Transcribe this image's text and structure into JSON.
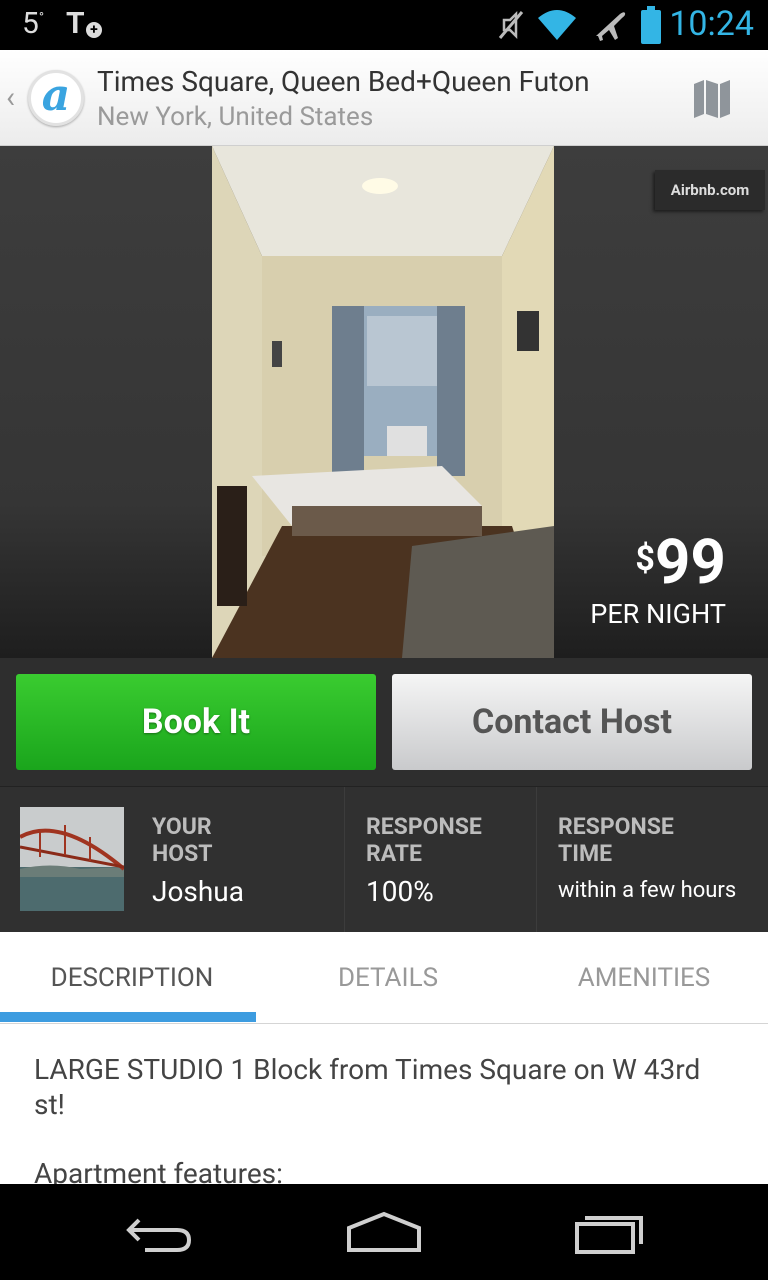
{
  "status_bar": {
    "temperature": "5",
    "temp_unit": "°",
    "t_letter": "T",
    "t_plus": "+",
    "time": "10:24",
    "icons": [
      "mute-icon",
      "wifi-icon",
      "airplane-icon",
      "battery-icon"
    ]
  },
  "header": {
    "logo_letter": "a",
    "title": "Times Square, Queen Bed+Queen Futon",
    "subtitle": "New York, United States",
    "map_icon": "map-icon"
  },
  "listing": {
    "watermark": "Airbnb.com",
    "currency": "$",
    "price": "99",
    "price_unit": "PER NIGHT"
  },
  "actions": {
    "book_label": "Book It",
    "contact_label": "Contact Host"
  },
  "host": {
    "your_host_label": [
      "YOUR",
      "HOST"
    ],
    "name": "Joshua",
    "response_rate_label": [
      "RESPONSE",
      "RATE"
    ],
    "response_rate": "100%",
    "response_time_label": [
      "RESPONSE",
      "TIME"
    ],
    "response_time": "within a few hours"
  },
  "tabs": [
    {
      "label": "DESCRIPTION",
      "active": true
    },
    {
      "label": "DETAILS",
      "active": false
    },
    {
      "label": "AMENITIES",
      "active": false
    }
  ],
  "description": {
    "line1": "LARGE STUDIO 1 Block from Times Square on W 43rd st!",
    "line2": "Apartment features:"
  },
  "colors": {
    "accent": "#33b5e5",
    "book_green": "#2bb826",
    "tab_indicator": "#3d9ce0"
  }
}
